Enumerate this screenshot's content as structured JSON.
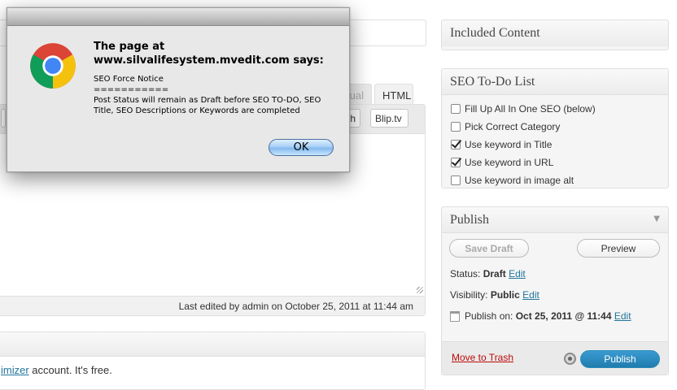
{
  "editor": {
    "tab_visual": "isual",
    "tab_html": "HTML",
    "qt_buttons": {
      "oembed": "eoh",
      "bliptv": "Blip.tv"
    },
    "last_edited": "Last edited by admin on October 25, 2011 at 11:44 am",
    "promo_link": "imizer",
    "promo_text": " account. It's free."
  },
  "sidebar": {
    "included_content": {
      "title": "Included Content"
    },
    "seo_todo": {
      "title": "SEO To-Do List",
      "items": [
        {
          "label": "Fill Up All In One SEO (below)",
          "checked": false
        },
        {
          "label": "Pick Correct Category",
          "checked": false
        },
        {
          "label": "Use keyword in Title",
          "checked": true
        },
        {
          "label": "Use keyword in URL",
          "checked": true
        },
        {
          "label": "Use keyword in image alt",
          "checked": false
        }
      ]
    },
    "publish": {
      "title": "Publish",
      "toggle_icon": "triangle-down",
      "save_draft": "Save Draft",
      "preview": "Preview",
      "status_label": "Status:",
      "status_value": "Draft",
      "visibility_label": "Visibility:",
      "visibility_value": "Public",
      "publish_on_label": "Publish on:",
      "publish_on_value": "Oct 25, 2011 @ 11:44",
      "edit_label": "Edit",
      "move_to_trash": "Move to Trash",
      "publish_button": "Publish"
    }
  },
  "dialog": {
    "title_line1": "The page at",
    "title_line2": "www.silvalifesystem.mvedit.com says:",
    "message": "SEO Force Notice\n===========\nPost Status will remain as Draft before SEO TO-DO, SEO Title, SEO Descriptions or Keywords are completed",
    "ok_label": "OK",
    "icon": "chrome-logo"
  },
  "colors": {
    "link": "#21759b",
    "trash": "#bc0b0b",
    "publish_button": "#2a85bd"
  }
}
